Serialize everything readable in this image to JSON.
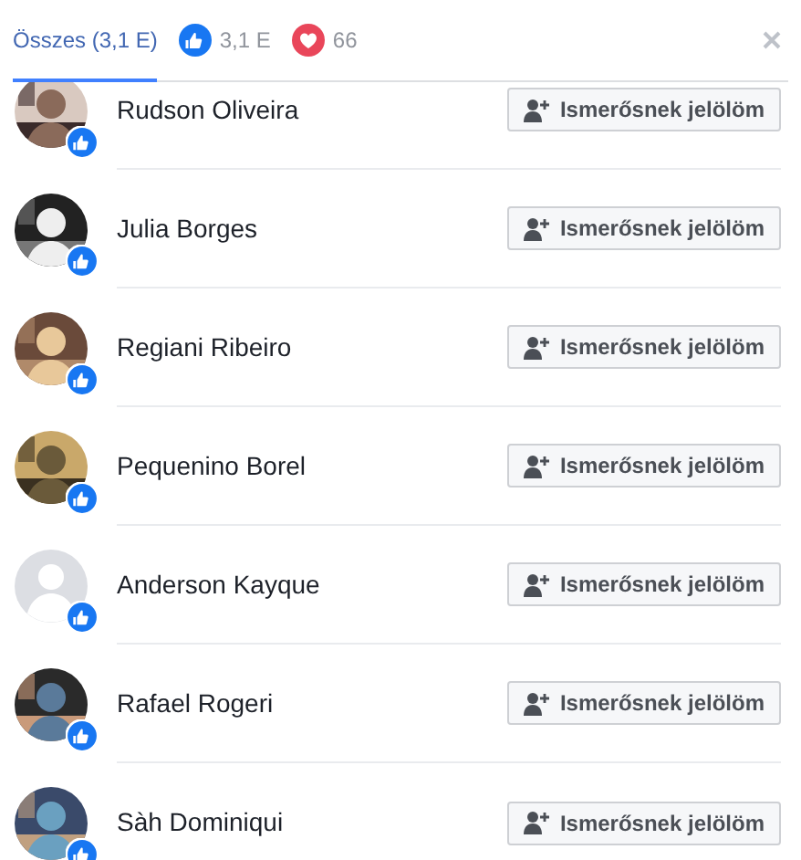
{
  "tabs": [
    {
      "kind": "all",
      "label": "Összes (3,1 E)",
      "selected": true
    },
    {
      "kind": "like",
      "label": "3,1 E",
      "selected": false
    },
    {
      "kind": "love",
      "label": "66",
      "selected": false
    }
  ],
  "people": [
    {
      "name": "Rudson Oliveira",
      "button": "Ismerősnek jelölöm"
    },
    {
      "name": "Julia Borges",
      "button": "Ismerősnek jelölöm"
    },
    {
      "name": "Regiani Ribeiro",
      "button": "Ismerősnek jelölöm"
    },
    {
      "name": "Pequenino Borel",
      "button": "Ismerősnek jelölöm"
    },
    {
      "name": "Anderson Kayque",
      "avatar": {
        "kind": "placeholder"
      },
      "button": "Ismerősnek jelölöm"
    },
    {
      "name": "Rafael Rogeri",
      "button": "Ismerősnek jelölöm"
    },
    {
      "name": "Sàh Dominiqui",
      "button": "Ismerősnek jelölöm"
    }
  ]
}
